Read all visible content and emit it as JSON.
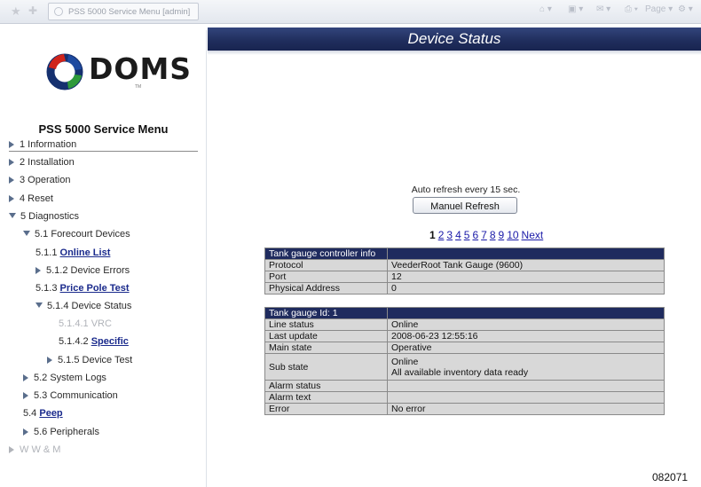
{
  "browser": {
    "tab_title": "PSS 5000 Service Menu [admin]",
    "page_menu": "Page"
  },
  "sidebar": {
    "logo_text": "DOMS",
    "trademark": "TM",
    "menu_title": "PSS 5000 Service Menu",
    "colors": {
      "logo_red": "#d0241b",
      "logo_blue": "#1e4aa0",
      "logo_green": "#2e9a3a",
      "logo_navy": "#15306f"
    },
    "items": {
      "information": "1 Information",
      "installation": "2 Installation",
      "operation": "3 Operation",
      "reset": "4 Reset",
      "diagnostics": "5 Diagnostics",
      "forecourt_devices": "5.1 Forecourt Devices",
      "online_list_num": "5.1.1",
      "online_list": "Online List",
      "device_errors": "5.1.2 Device Errors",
      "price_pole_num": "5.1.3",
      "price_pole": "Price Pole Test",
      "device_status": "5.1.4 Device Status",
      "vrc": "5.1.4.1 VRC",
      "specific_num": "5.1.4.2",
      "specific": "Specific",
      "device_test": "5.1.5 Device Test",
      "system_logs": "5.2 System Logs",
      "communication": "5.3 Communication",
      "peep_num": "5.4",
      "peep": "Peep",
      "peripherals": "5.6 Peripherals",
      "wwm": "W W & M"
    }
  },
  "main": {
    "title": "Device Status",
    "header_color": "#1f2b5e",
    "auto_refresh": "Auto refresh every 15 sec.",
    "refresh_button": "Manuel Refresh",
    "pager": {
      "current": "1",
      "pages": [
        "2",
        "3",
        "4",
        "5",
        "6",
        "7",
        "8",
        "9",
        "10"
      ],
      "next": "Next"
    },
    "controller_table": {
      "header": "Tank gauge controller info",
      "rows": [
        {
          "label": "Protocol",
          "value": "VeederRoot Tank Gauge (9600)"
        },
        {
          "label": "Port",
          "value": "12"
        },
        {
          "label": "Physical Address",
          "value": "0"
        }
      ]
    },
    "gauge_table": {
      "header": "Tank gauge Id: 1",
      "rows": [
        {
          "label": "Line status",
          "value": "Online"
        },
        {
          "label": "Last update",
          "value": "2008-06-23 12:55:16"
        },
        {
          "label": "Main state",
          "value": "Operative"
        },
        {
          "label": "Sub state",
          "value": "Online",
          "value2": "All available inventory data ready"
        },
        {
          "label": "Alarm status",
          "value": ""
        },
        {
          "label": "Alarm text",
          "value": ""
        },
        {
          "label": "Error",
          "value": "No error"
        }
      ]
    },
    "figure_number": "082071"
  }
}
